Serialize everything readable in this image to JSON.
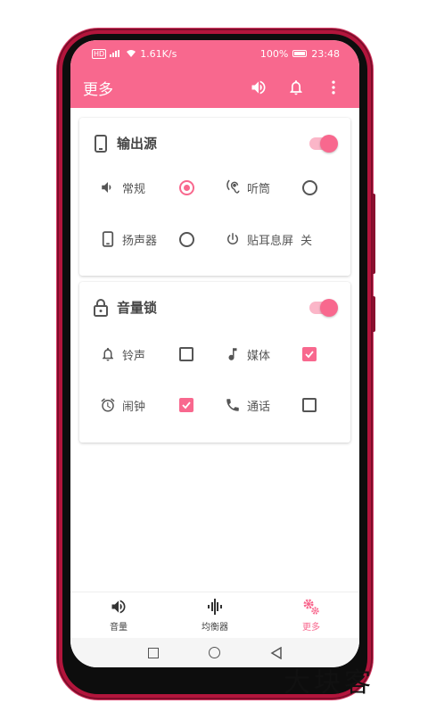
{
  "status": {
    "network_speed": "1.61K/s",
    "battery": "100%",
    "time": "23:48"
  },
  "appbar": {
    "title": "更多",
    "icons": [
      "volume-icon",
      "bell-icon",
      "more-vert-icon"
    ]
  },
  "output_source": {
    "title": "输出源",
    "enabled": true,
    "options": [
      {
        "label": "常规",
        "icon": "volume-icon",
        "selected": true
      },
      {
        "label": "听筒",
        "icon": "ear-icon",
        "selected": false
      },
      {
        "label": "扬声器",
        "icon": "phone-icon",
        "selected": false
      }
    ],
    "proximity": {
      "label": "贴耳息屏",
      "value": "关",
      "icon": "power-icon"
    }
  },
  "volume_lock": {
    "title": "音量锁",
    "enabled": true,
    "options": [
      {
        "label": "铃声",
        "icon": "bell-icon",
        "checked": false
      },
      {
        "label": "媒体",
        "icon": "music-note-icon",
        "checked": true
      },
      {
        "label": "闹钟",
        "icon": "alarm-icon",
        "checked": true
      },
      {
        "label": "通话",
        "icon": "phone-call-icon",
        "checked": false
      }
    ]
  },
  "bottom_nav": [
    {
      "label": "音量",
      "icon": "volume-icon",
      "active": false
    },
    {
      "label": "均衡器",
      "icon": "equalizer-icon",
      "active": false
    },
    {
      "label": "更多",
      "icon": "gears-icon",
      "active": true
    }
  ],
  "watermark": "大块客",
  "colors": {
    "accent": "#f8688e",
    "accent_light": "#fbb6c8",
    "phone_frame": "#b3153c"
  }
}
